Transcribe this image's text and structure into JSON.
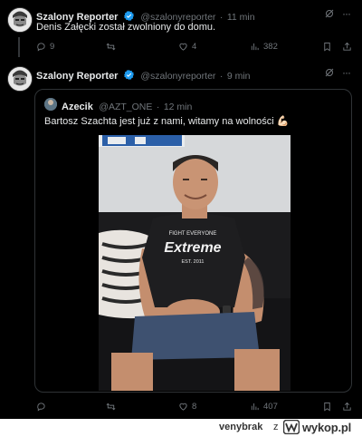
{
  "tweet1": {
    "name": "Szalony Reporter",
    "handle": "@szalonyreporter",
    "time": "11 min",
    "text": "Denis Załęcki został zwolniony do domu.",
    "replies": "9",
    "retweets": "",
    "likes": "4",
    "views": "382"
  },
  "tweet2": {
    "name": "Szalony Reporter",
    "handle": "@szalonyreporter",
    "time": "9 min",
    "quote": {
      "name": "Azecik",
      "handle": "@AZT_ONE",
      "time": "12 min",
      "text": "Bartosz Szachta jest już z nami, witamy na wolności",
      "emoji": "💪🏻",
      "shirt_line1": "FIGHT EVERYONE",
      "shirt_line2": "Extreme",
      "shirt_line3": "EST. 2011"
    },
    "replies": "",
    "retweets": "",
    "likes": "8",
    "views": "407"
  },
  "separator": "·",
  "footer": {
    "user": "venybrak",
    "z": "z",
    "site": "wykop.pl"
  },
  "colors": {
    "background": "#000000",
    "text": "#e7e9ea",
    "muted": "#71767b",
    "verified": "#1d9bf0",
    "border": "#2f3336"
  }
}
